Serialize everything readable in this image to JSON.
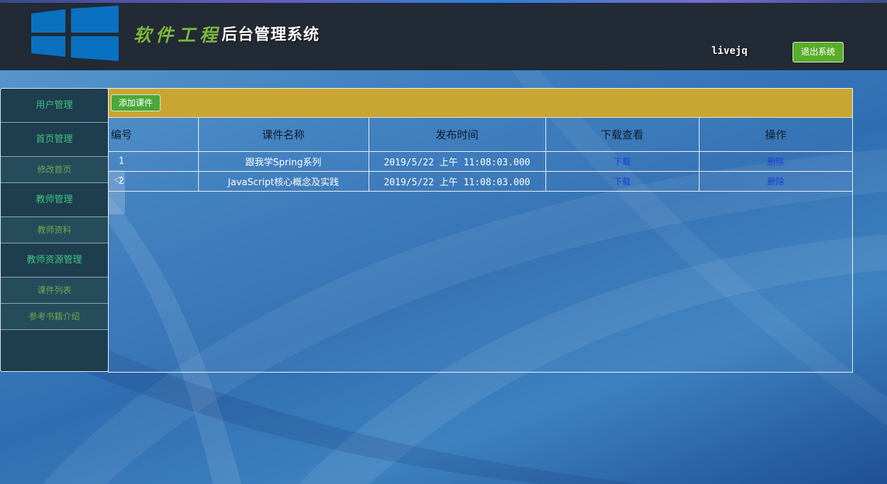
{
  "header": {
    "brand_part1": "软件工程",
    "brand_part2": "后台管理系统",
    "username": "livejq",
    "logout_label": "退出系统"
  },
  "sidebar": {
    "items": [
      {
        "label": "用户管理",
        "level": "category"
      },
      {
        "label": "首页管理",
        "level": "category"
      },
      {
        "label": "修改首页",
        "level": "sub"
      },
      {
        "label": "教师管理",
        "level": "category"
      },
      {
        "label": "教师资料",
        "level": "sub"
      },
      {
        "label": "教师资源管理",
        "level": "category"
      },
      {
        "label": "课件列表",
        "level": "sub"
      },
      {
        "label": "参考书籍介绍",
        "level": "sub"
      }
    ]
  },
  "toolbar": {
    "add_label": "添加课件"
  },
  "table": {
    "columns": [
      "编号",
      "课件名称",
      "发布时间",
      "下载查看",
      "操作"
    ],
    "rows": [
      {
        "id": "1",
        "name": "跟我学Spring系列",
        "time": "2019/5/22 上午 11:08:03.000",
        "download": "下载",
        "action": "删除"
      },
      {
        "id": "2",
        "name": "JavaScript核心概念及实践",
        "time": "2019/5/22 上午 11:08:03.000",
        "download": "下载",
        "action": "删除"
      }
    ]
  },
  "scroll_arrow": "◁",
  "colors": {
    "header_bg": "#212a35",
    "toolbar_gold": "#c9a533",
    "sidebar_bg": "#1e3d4e",
    "nav_green": "#3ec482",
    "button_green": "#5aad2a",
    "link_blue": "#1a3fd8"
  }
}
